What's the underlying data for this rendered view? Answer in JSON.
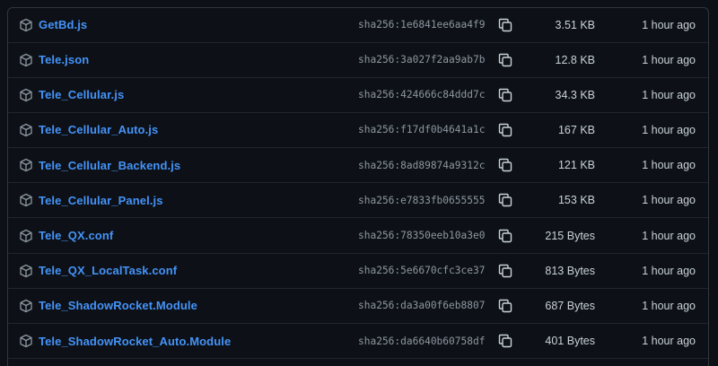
{
  "colors": {
    "background": "#0d1117",
    "border": "#30363d",
    "link": "#4493f8",
    "muted": "#8d96a0",
    "text": "#c9d1d9"
  },
  "row_icon": "package-icon",
  "copy_icon": "copy-icon",
  "files": [
    {
      "name": "GetBd.js",
      "hash": "sha256:1e6841ee6aa4f9",
      "size": "3.51 KB",
      "time": "1 hour ago"
    },
    {
      "name": "Tele.json",
      "hash": "sha256:3a027f2aa9ab7b",
      "size": "12.8 KB",
      "time": "1 hour ago"
    },
    {
      "name": "Tele_Cellular.js",
      "hash": "sha256:424666c84ddd7c",
      "size": "34.3 KB",
      "time": "1 hour ago"
    },
    {
      "name": "Tele_Cellular_Auto.js",
      "hash": "sha256:f17df0b4641a1c",
      "size": "167 KB",
      "time": "1 hour ago"
    },
    {
      "name": "Tele_Cellular_Backend.js",
      "hash": "sha256:8ad89874a9312c",
      "size": "121 KB",
      "time": "1 hour ago"
    },
    {
      "name": "Tele_Cellular_Panel.js",
      "hash": "sha256:e7833fb0655555",
      "size": "153 KB",
      "time": "1 hour ago"
    },
    {
      "name": "Tele_QX.conf",
      "hash": "sha256:78350eeb10a3e0",
      "size": "215 Bytes",
      "time": "1 hour ago"
    },
    {
      "name": "Tele_QX_LocalTask.conf",
      "hash": "sha256:5e6670cfc3ce37",
      "size": "813 Bytes",
      "time": "1 hour ago"
    },
    {
      "name": "Tele_ShadowRocket.Module",
      "hash": "sha256:da3a00f6eb8807",
      "size": "687 Bytes",
      "time": "1 hour ago"
    },
    {
      "name": "Tele_ShadowRocket_Auto.Module",
      "hash": "sha256:da6640b60758df",
      "size": "401 Bytes",
      "time": "1 hour ago"
    }
  ]
}
